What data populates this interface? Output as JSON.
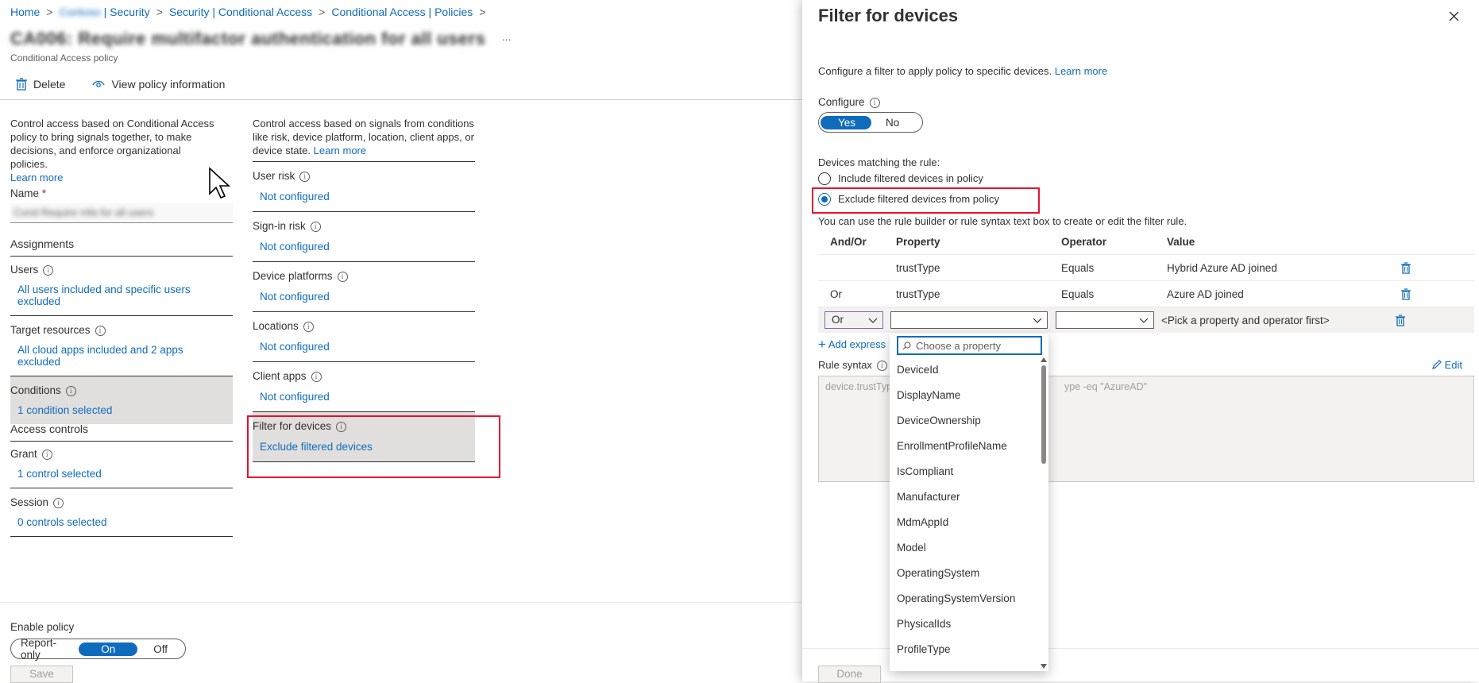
{
  "breadcrumb": {
    "home": "Home",
    "tenant_security": "| Security",
    "tenant_redacted": "Contoso",
    "ca": "Security | Conditional Access",
    "policies": "Conditional Access | Policies"
  },
  "policy": {
    "title": "CA006: Require multifactor authentication for all users",
    "subtitle": "Conditional Access policy",
    "more": "..."
  },
  "toolbar": {
    "delete_label": "Delete",
    "view_info_label": "View policy information"
  },
  "left_desc": {
    "text": "Control access based on Conditional Access policy to bring signals together, to make decisions, and enforce organizational policies.",
    "learn_more": "Learn more"
  },
  "name_field": {
    "label": "Name",
    "required": "*",
    "value": "Cond Require mfa for all users"
  },
  "assignments": {
    "heading": "Assignments",
    "users": {
      "label": "Users",
      "value": "All users included and specific users excluded"
    },
    "target": {
      "label": "Target resources",
      "value": "All cloud apps included and 2 apps excluded"
    },
    "conditions": {
      "label": "Conditions",
      "value": "1 condition selected"
    }
  },
  "access_controls": {
    "heading": "Access controls",
    "grant": {
      "label": "Grant",
      "value": "1 control selected"
    },
    "session": {
      "label": "Session",
      "value": "0 controls selected"
    }
  },
  "conditions_desc": {
    "text": "Control access based on signals from conditions like risk, device platform, location, client apps, or device state.",
    "learn_more": "Learn more"
  },
  "conditions": [
    {
      "label": "User risk",
      "value": "Not configured"
    },
    {
      "label": "Sign-in risk",
      "value": "Not configured"
    },
    {
      "label": "Device platforms",
      "value": "Not configured"
    },
    {
      "label": "Locations",
      "value": "Not configured"
    },
    {
      "label": "Client apps",
      "value": "Not configured"
    },
    {
      "label": "Filter for devices",
      "value": "Exclude filtered devices"
    }
  ],
  "enable_policy": {
    "label": "Enable policy",
    "options": [
      "Report-only",
      "On",
      "Off"
    ],
    "selected": "On",
    "save_label": "Save"
  },
  "panel": {
    "title": "Filter for devices",
    "intro": "Configure a filter to apply policy to specific devices.",
    "learn_more": "Learn more",
    "configure_label": "Configure",
    "configure_options": [
      "Yes",
      "No"
    ],
    "configure_selected": "Yes",
    "matching_label": "Devices matching the rule:",
    "include_option": "Include filtered devices in policy",
    "exclude_option": "Exclude filtered devices from policy",
    "rule_hint": "You can use the rule builder or rule syntax text box to create or edit the filter rule.",
    "columns": [
      "And/Or",
      "Property",
      "Operator",
      "Value"
    ],
    "rows": [
      {
        "andor": "",
        "property": "trustType",
        "operator": "Equals",
        "value": "Hybrid Azure AD joined"
      },
      {
        "andor": "Or",
        "property": "trustType",
        "operator": "Equals",
        "value": "Azure AD joined"
      }
    ],
    "edit_row": {
      "andor": "Or",
      "value_hint": "<Pick a property and operator first>"
    },
    "add_expression": "Add express",
    "rule_syntax_label": "Rule syntax",
    "edit_label": "Edit",
    "syntax_left": "device.trustTyp",
    "syntax_right": "ype -eq \"AzureAD\"",
    "done_label": "Done"
  },
  "dropdown": {
    "placeholder": "Choose a property",
    "options": [
      "DeviceId",
      "DisplayName",
      "DeviceOwnership",
      "EnrollmentProfileName",
      "IsCompliant",
      "Manufacturer",
      "MdmAppId",
      "Model",
      "OperatingSystem",
      "OperatingSystemVersion",
      "PhysicalIds",
      "ProfileType"
    ]
  },
  "colors": {
    "accent": "#0f6cbd",
    "highlight_box": "#e8112d",
    "selected_bg": "#e1dfdd"
  }
}
